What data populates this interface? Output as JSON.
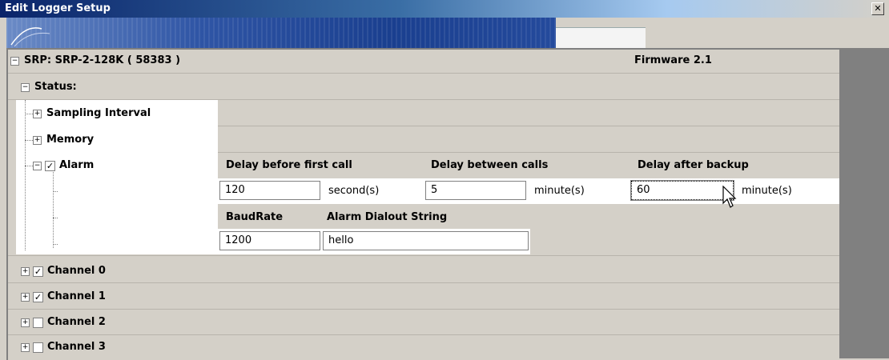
{
  "window": {
    "title": "Edit Logger Setup",
    "close_glyph": "✕"
  },
  "device": {
    "label": "SRP: SRP-2-128K ( 58383 )",
    "firmware": "Firmware 2.1",
    "toggle": "−"
  },
  "tree": {
    "status_label": "Status:",
    "status_toggle": "−",
    "sampling_label": "Sampling Interval",
    "sampling_toggle": "+",
    "memory_label": "Memory",
    "memory_toggle": "+",
    "alarm_label": "Alarm",
    "alarm_toggle": "−",
    "alarm_checked": "✓",
    "channels": [
      {
        "label": "Channel 0",
        "toggle": "+",
        "check": "✓"
      },
      {
        "label": "Channel 1",
        "toggle": "+",
        "check": "✓"
      },
      {
        "label": "Channel 2",
        "toggle": "+",
        "check": ""
      },
      {
        "label": "Channel 3",
        "toggle": "+",
        "check": ""
      }
    ]
  },
  "alarm": {
    "delay_first_label": "Delay before first call",
    "delay_between_label": "Delay between calls",
    "delay_backup_label": "Delay after backup",
    "delay_first_value": "120",
    "delay_first_unit": "second(s)",
    "delay_between_value": "5",
    "delay_between_unit": "minute(s)",
    "delay_backup_value": "60",
    "delay_backup_unit": "minute(s)",
    "baud_label": "BaudRate",
    "dialout_label": "Alarm Dialout String",
    "baud_value": "1200",
    "dialout_value": "hello"
  },
  "icons": {
    "close": "close-icon",
    "cursor": "mouse-cursor-icon"
  }
}
